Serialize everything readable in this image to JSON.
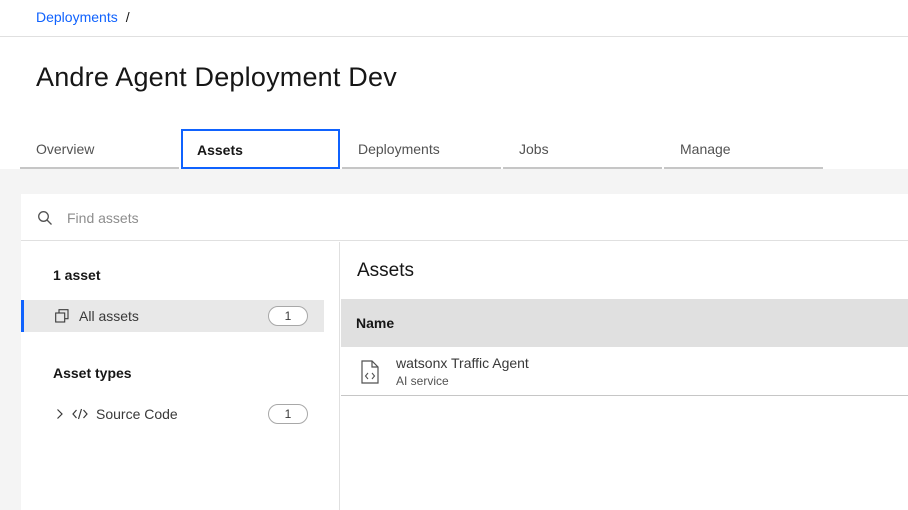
{
  "breadcrumb": {
    "link": "Deployments",
    "separator": "/"
  },
  "page": {
    "title": "Andre Agent Deployment Dev"
  },
  "tabs": [
    {
      "label": "Overview",
      "active": false
    },
    {
      "label": "Assets",
      "active": true
    },
    {
      "label": "Deployments",
      "active": false
    },
    {
      "label": "Jobs",
      "active": false
    },
    {
      "label": "Manage",
      "active": false
    }
  ],
  "search": {
    "placeholder": "Find assets",
    "value": "",
    "icon": "search-icon"
  },
  "sidebar": {
    "count_heading": "1 asset",
    "all_assets": {
      "label": "All assets",
      "count": "1",
      "icon": "copy-icon"
    },
    "types_heading": "Asset types",
    "types": [
      {
        "label": "Source Code",
        "count": "1",
        "icon": "code-icon"
      }
    ]
  },
  "assets": {
    "title": "Assets",
    "columns": [
      "Name"
    ],
    "rows": [
      {
        "name": "watsonx Traffic Agent",
        "type": "AI service",
        "icon": "source-file-icon"
      }
    ]
  },
  "colors": {
    "accent": "#0f62fe",
    "background": "#f4f4f4",
    "header_row": "#e0e0e0"
  }
}
